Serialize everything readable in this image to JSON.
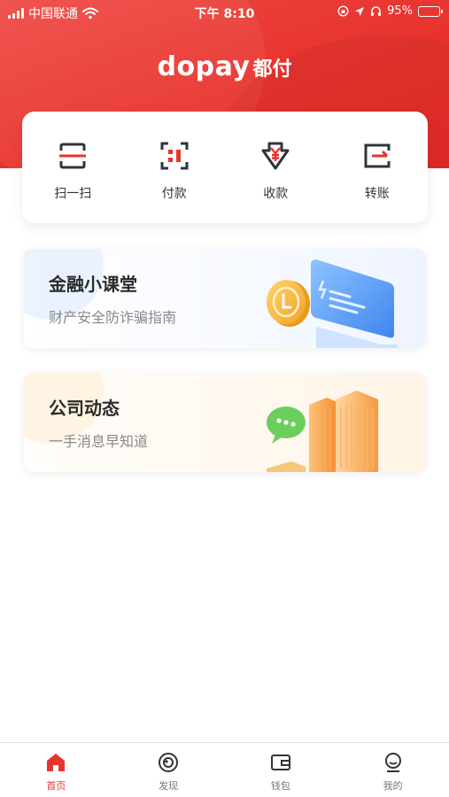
{
  "status_bar": {
    "carrier": "中国联通",
    "time": "下午 8:10",
    "battery": "95%",
    "battery_level": 0.95
  },
  "header": {
    "logo_latin": "dopay",
    "logo_cjk": "都付"
  },
  "quick_actions": [
    {
      "label": "扫一扫",
      "icon": "scan-icon"
    },
    {
      "label": "付款",
      "icon": "pay-code-icon"
    },
    {
      "label": "收款",
      "icon": "receive-yuan-icon"
    },
    {
      "label": "转账",
      "icon": "transfer-icon"
    }
  ],
  "cards": [
    {
      "title": "金融小课堂",
      "subtitle": "财产安全防诈骗指南",
      "icon": "coin-monitor-illustration"
    },
    {
      "title": "公司动态",
      "subtitle": "一手消息早知道",
      "icon": "buildings-chat-illustration"
    }
  ],
  "tabs": [
    {
      "label": "首页",
      "icon": "home-icon",
      "active": true
    },
    {
      "label": "发现",
      "icon": "discover-icon",
      "active": false
    },
    {
      "label": "钱包",
      "icon": "wallet-icon",
      "active": false
    },
    {
      "label": "我的",
      "icon": "profile-icon",
      "active": false
    }
  ],
  "colors": {
    "brand_red": "#e8332e",
    "icon_dark": "#2f3437"
  }
}
